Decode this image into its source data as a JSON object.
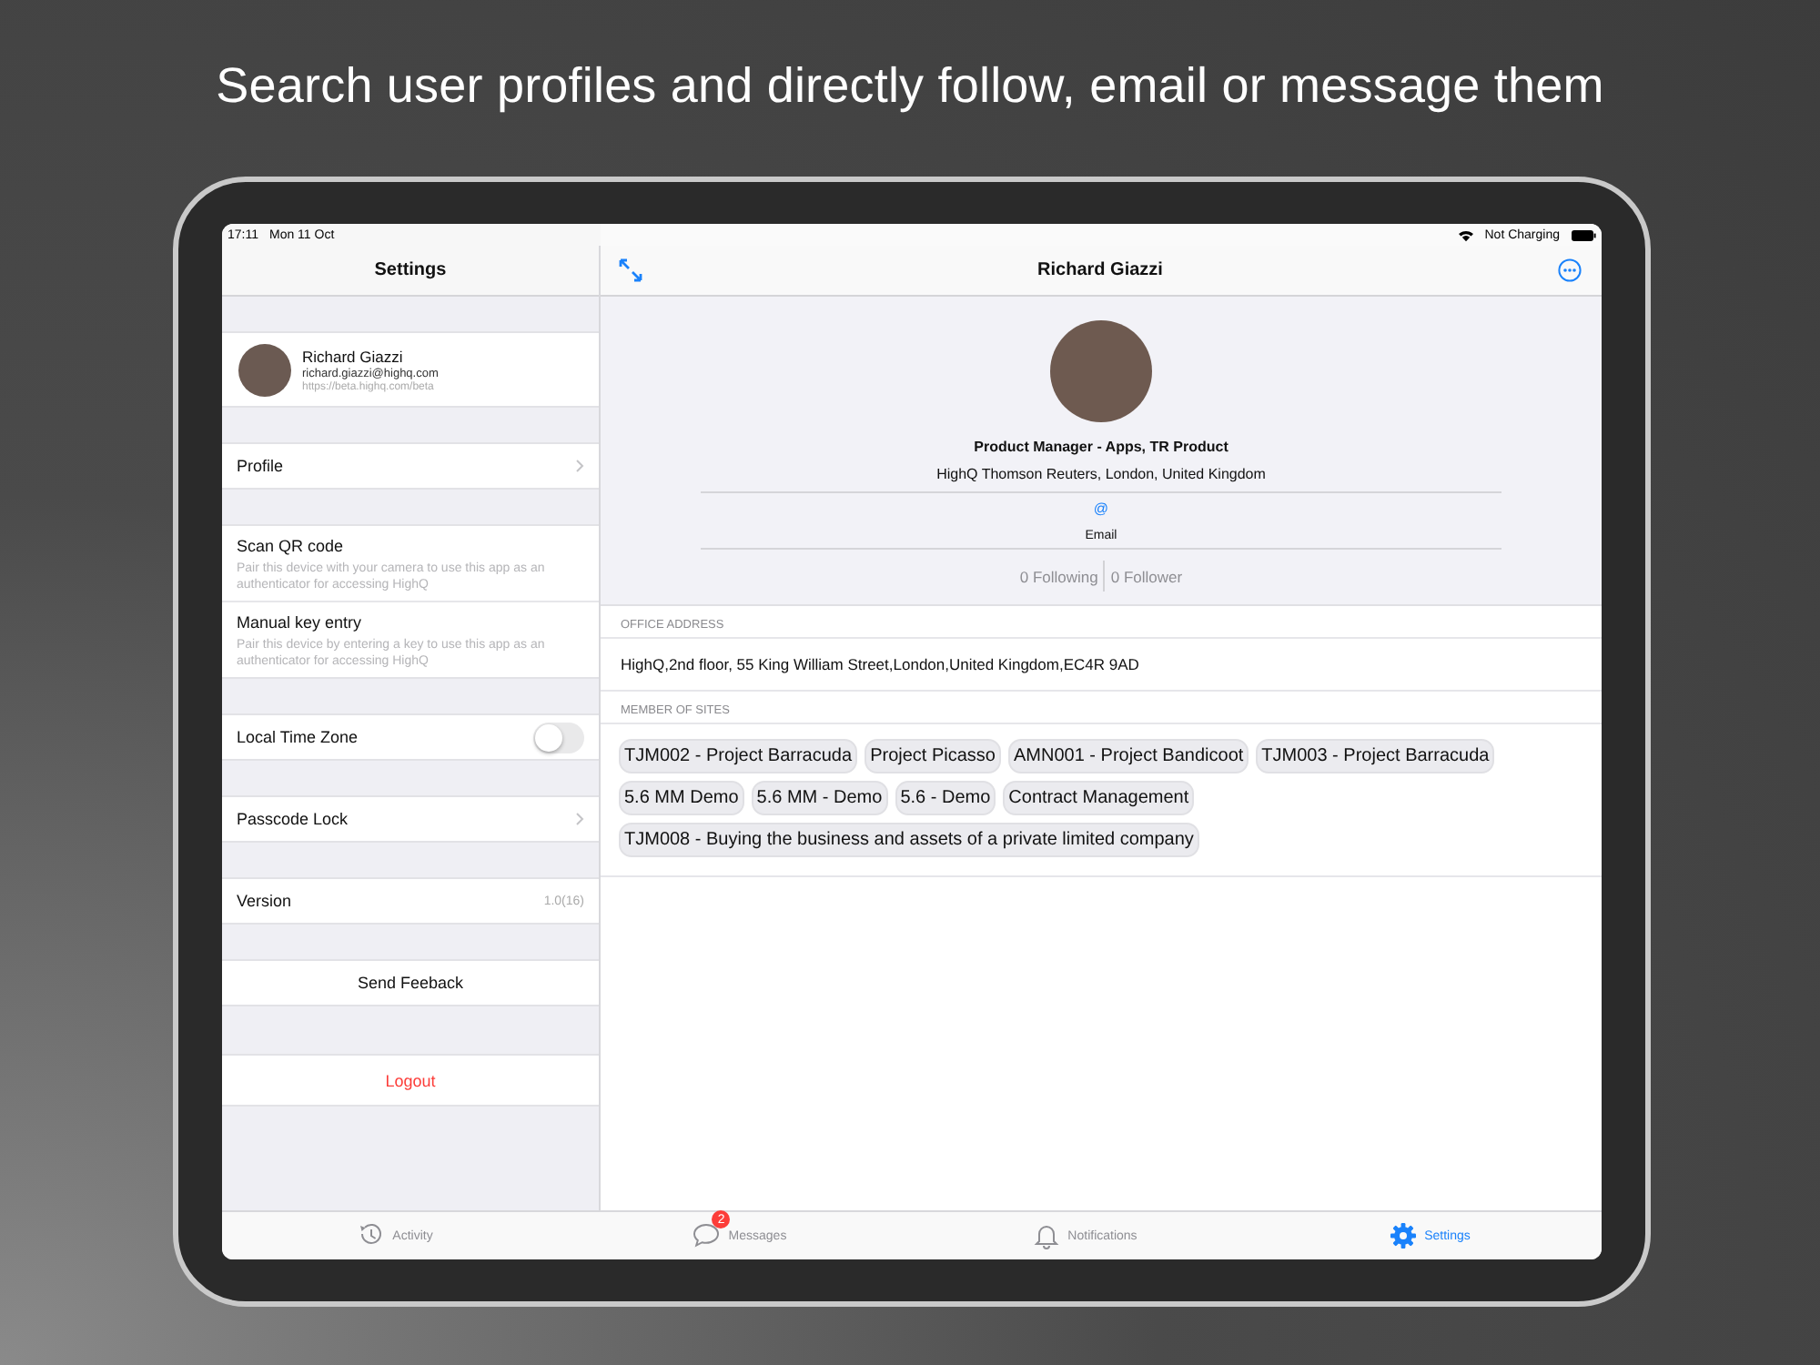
{
  "headline": "Search user profiles and directly follow, email or message them",
  "status_bar": {
    "time": "17:11",
    "date": "Mon 11 Oct",
    "battery_text": "Not Charging"
  },
  "settings": {
    "title": "Settings",
    "account": {
      "name": "Richard Giazzi",
      "email": "richard.giazzi@highq.com",
      "url": "https://beta.highq.com/beta"
    },
    "sections": [
      [
        {
          "kind": "link",
          "label": "Profile"
        }
      ],
      [
        {
          "kind": "info",
          "label": "Scan QR code",
          "description": "Pair this device with your camera to use this app as an authenticator for accessing HighQ"
        },
        {
          "kind": "info",
          "label": "Manual key entry",
          "description": "Pair this device by entering a key to use this app as an authenticator for accessing HighQ"
        }
      ],
      [
        {
          "kind": "toggle",
          "label": "Local Time Zone",
          "on": false
        }
      ],
      [
        {
          "kind": "link",
          "label": "Passcode Lock"
        }
      ],
      [
        {
          "kind": "value",
          "label": "Version",
          "value": "1.0(16)"
        }
      ],
      [
        {
          "kind": "action",
          "label": "Send Feeback"
        }
      ],
      [
        {
          "kind": "destructive",
          "label": "Logout"
        }
      ]
    ]
  },
  "profile": {
    "title": "Richard Giazzi",
    "job_title": "Product Manager - Apps, TR Product",
    "company": "HighQ Thomson Reuters, London, United Kingdom",
    "actions": [
      {
        "symbol": "@",
        "label": "Email"
      }
    ],
    "following": "0 Following",
    "followers": "0 Follower",
    "office_address": {
      "heading": "OFFICE ADDRESS",
      "value": "HighQ,2nd floor, 55 King William Street,London,United Kingdom,EC4R 9AD"
    },
    "sites": {
      "heading": "MEMBER OF SITES",
      "items": [
        "TJM002 - Project Barracuda",
        "Project Picasso",
        "AMN001 - Project Bandicoot",
        "TJM003 - Project Barracuda",
        "5.6 MM Demo",
        "5.6 MM - Demo",
        "5.6 - Demo",
        "Contract Management",
        "TJM008 - Buying the business and assets of a private limited company"
      ]
    }
  },
  "tabs": [
    {
      "kind": "activity",
      "label": "Activity",
      "selected": false
    },
    {
      "kind": "messages",
      "label": "Messages",
      "selected": false,
      "badge": "2"
    },
    {
      "kind": "notifications",
      "label": "Notifications",
      "selected": false
    },
    {
      "kind": "settings",
      "label": "Settings",
      "selected": true
    }
  ]
}
